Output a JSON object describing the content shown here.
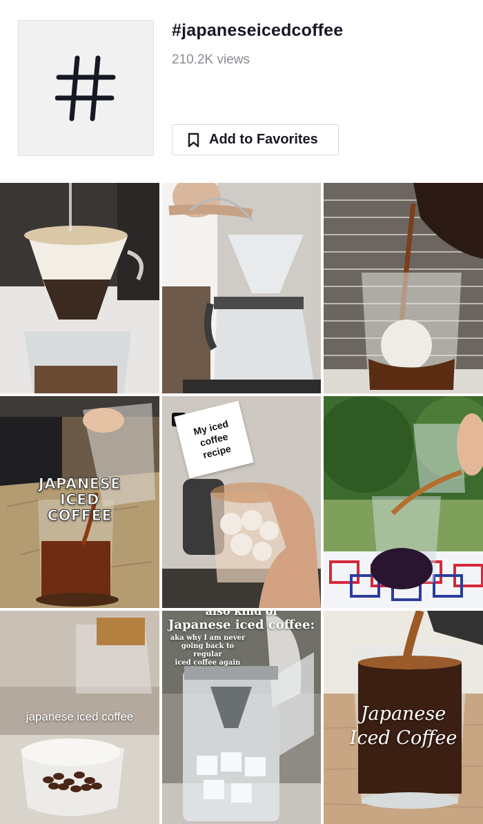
{
  "hashtag": {
    "icon": "hashtag-icon",
    "title": "#japaneseicedcoffee",
    "views": "210.2K views"
  },
  "favorites": {
    "icon": "bookmark-icon",
    "label": "Add to Favorites"
  },
  "videos": {
    "v4_overlay": [
      "JAPANESE",
      "ICED",
      "COFFEE"
    ],
    "v5_note": [
      "My iced",
      "coffee",
      "recipe"
    ],
    "v7_overlay": "japanese iced coffee",
    "v8_top": "also kind of",
    "v8_title": "Japanese iced coffee:",
    "v8_sub": [
      "aka why I am never",
      "going back to regular",
      "iced coffee again"
    ],
    "v9_overlay": [
      "Japanese",
      "Iced Coffee"
    ]
  }
}
